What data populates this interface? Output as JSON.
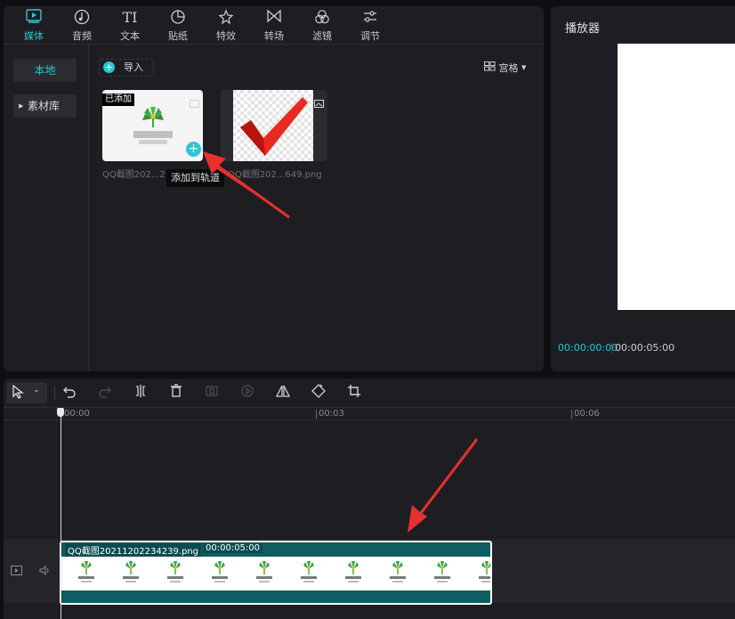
{
  "toolbar": {
    "tabs": [
      {
        "label": "媒体",
        "icon": "media-play-icon",
        "active": true
      },
      {
        "label": "音频",
        "icon": "music-note-icon"
      },
      {
        "label": "文本",
        "icon": "text-ti-icon",
        "glyph": "TI"
      },
      {
        "label": "贴纸",
        "icon": "sticker-icon"
      },
      {
        "label": "特效",
        "icon": "sparkle-star-icon"
      },
      {
        "label": "转场",
        "icon": "bowtie-transition-icon"
      },
      {
        "label": "滤镜",
        "icon": "filter-circles-icon"
      },
      {
        "label": "调节",
        "icon": "sliders-icon"
      }
    ]
  },
  "sidebar": {
    "local": "本地",
    "library": "素材库"
  },
  "media": {
    "import_label": "导入",
    "view_label": "宫格",
    "items": [
      {
        "name": "QQ截图202...2",
        "badge": "已添加"
      },
      {
        "name": "QQ截图202...649.png"
      }
    ],
    "tooltip": "添加到轨道"
  },
  "player": {
    "title": "播放器",
    "current_time": "00:00:00:00",
    "total_time": "00:00:05:00"
  },
  "timeline": {
    "ticks": [
      "00:00",
      "00:03",
      "00:06"
    ],
    "clip": {
      "name": "QQ截图20211202234239.png",
      "duration": "00:00:05:00"
    }
  },
  "colors": {
    "accent": "#2bc5d6",
    "clip": "#0e5d62",
    "arrow": "#e8312f"
  }
}
